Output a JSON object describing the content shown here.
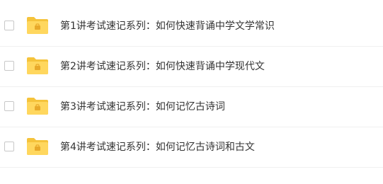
{
  "files": [
    {
      "name": "第1讲考试速记系列：如何快速背诵中学文学常识",
      "icon": "folder-icon"
    },
    {
      "name": "第2讲考试速记系列：如何快速背诵中学现代文",
      "icon": "folder-icon"
    },
    {
      "name": "第3讲考试速记系列：如何记忆古诗词",
      "icon": "folder-icon"
    },
    {
      "name": "第4讲考试速记系列：如何记忆古诗词和古文",
      "icon": "folder-icon"
    }
  ],
  "colors": {
    "folder_back": "#f5c33b",
    "folder_front": "#ffd75e",
    "folder_mark": "#e8a92a",
    "text": "#333333",
    "divider": "#f0f0f0",
    "checkbox_border": "#c8c8c8"
  }
}
